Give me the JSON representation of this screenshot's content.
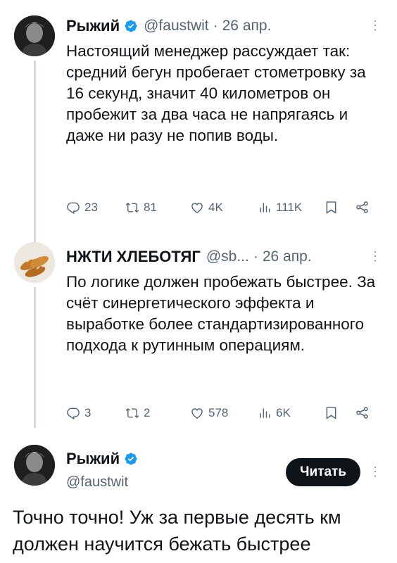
{
  "tweet1": {
    "name": "Рыжий",
    "handle": "@faustwit",
    "dot": "·",
    "date": "26 апр.",
    "text": "Настоящий менеджер рассуждает так: средний бегун пробегает стометровку за 16 секунд, значит 40 километров он пробежит за два часа не напрягаясь и даже ни разу не попив воды.",
    "replies": "23",
    "retweets": "81",
    "likes": "4K",
    "views": "111K"
  },
  "tweet2": {
    "name": "НЖТИ ХЛЕБОТЯГ",
    "handle": "@sb...",
    "dot": "·",
    "date": "26 апр.",
    "text": "По логике должен пробежать быстрее. За счёт синергетического эффекта и выработке более стандартизированного подхода к рутинным операциям.",
    "replies": "3",
    "retweets": "2",
    "likes": "578",
    "views": "6K"
  },
  "tweet3": {
    "name": "Рыжий",
    "handle": "@faustwit",
    "follow_label": "Читать",
    "text": "Точно точно! Уж за первые десять км должен научится бежать быстрее"
  },
  "icons": {
    "verified": "verified-badge-icon",
    "reply": "reply-icon",
    "retweet": "retweet-icon",
    "like": "heart-icon",
    "views": "views-bar-chart-icon",
    "bookmark": "bookmark-icon",
    "share": "share-icon",
    "more": "more-dots-icon"
  },
  "colors": {
    "verified": "#1d9bf0",
    "muted": "#536471",
    "button": "#0f1419"
  }
}
